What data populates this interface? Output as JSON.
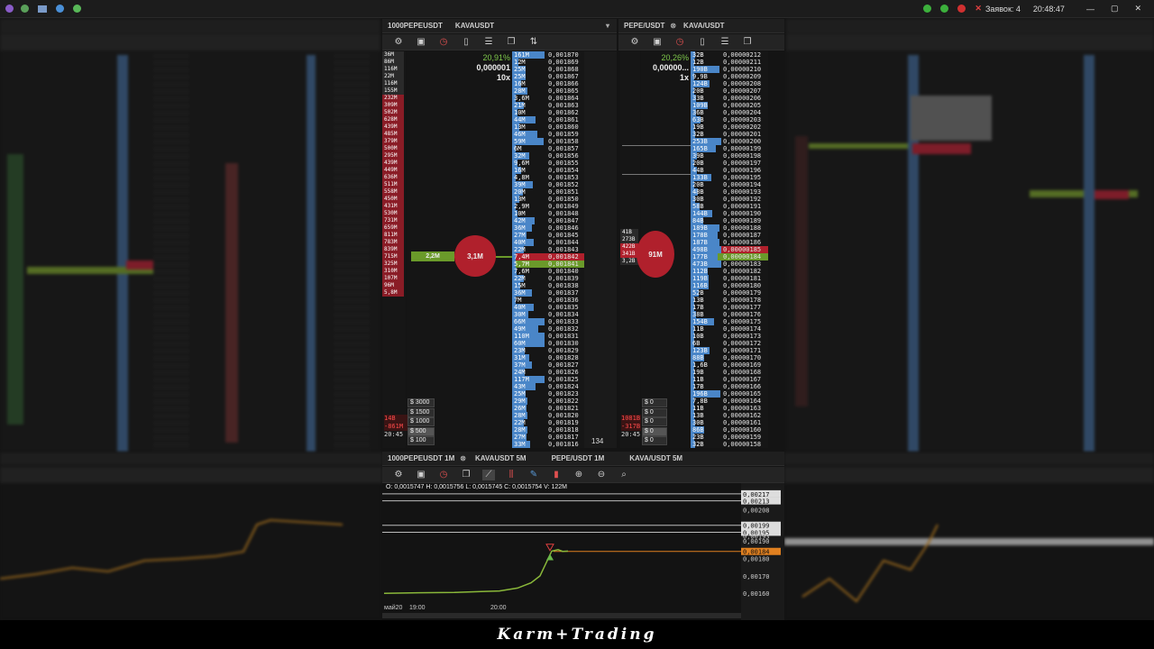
{
  "topbar": {
    "orders_label": "Заявок: 4",
    "clock": "20:48:47"
  },
  "panels": {
    "center_dom_tabs": [
      "1000PEPEUSDT",
      "KAVAUSDT"
    ],
    "right_dom_tabs": [
      "PEPE/USDT",
      "KAVA/USDT"
    ],
    "chart_tabs": [
      "1000PEPEUSDT 1M",
      "KAVAUSDT 5M",
      "PEPE/USDT 1M",
      "KAVA/USDT 5M"
    ]
  },
  "dom1": {
    "change": "20,91%",
    "tick": "0,000001",
    "mult": "10x",
    "bid_bubble": "2,2M",
    "circle": "3,1M",
    "bottom_count": "134",
    "amounts": [
      "$ 3000",
      "$ 1500",
      "$ 1000",
      "$ 500",
      "$ 100"
    ],
    "left_footer": [
      "14B",
      "-861M",
      "20:45"
    ],
    "left_sizes": [
      "36M",
      "86M",
      "116M",
      "22M",
      "116M",
      "155M",
      "232M",
      "309M",
      "502M",
      "628M",
      "439M",
      "485M",
      "379M",
      "500M",
      "295M",
      "439M",
      "449M",
      "636M",
      "511M",
      "558M",
      "450M",
      "431M",
      "530M",
      "731M",
      "659M",
      "811M",
      "783M",
      "839M",
      "715M",
      "325M",
      "310M",
      "107M",
      "96M",
      "5,8M"
    ],
    "rows": [
      [
        "161M",
        "0,001870"
      ],
      [
        "12M",
        "0,001869"
      ],
      [
        "25M",
        "0,001868"
      ],
      [
        "25M",
        "0,001867"
      ],
      [
        "16M",
        "0,001866"
      ],
      [
        "28M",
        "0,001865"
      ],
      [
        "3,6M",
        "0,001864"
      ],
      [
        "21M",
        "0,001863"
      ],
      [
        "10M",
        "0,001862"
      ],
      [
        "44M",
        "0,001861"
      ],
      [
        "13M",
        "0,001860"
      ],
      [
        "46M",
        "0,001859"
      ],
      [
        "59M",
        "0,001858"
      ],
      [
        "6M",
        "0,001857"
      ],
      [
        "32M",
        "0,001856"
      ],
      [
        "9,6M",
        "0,001855"
      ],
      [
        "16M",
        "0,001854"
      ],
      [
        "4,8M",
        "0,001853"
      ],
      [
        "39M",
        "0,001852"
      ],
      [
        "20M",
        "0,001851"
      ],
      [
        "13M",
        "0,001850"
      ],
      [
        "2,9M",
        "0,001849"
      ],
      [
        "10M",
        "0,001848"
      ],
      [
        "42M",
        "0,001847"
      ],
      [
        "36M",
        "0,001846"
      ],
      [
        "27M",
        "0,001845"
      ],
      [
        "40M",
        "0,001844"
      ],
      [
        "22M",
        "0,001843"
      ],
      [
        "7,4M",
        "0,001842"
      ],
      [
        "5,7M",
        "0,001841"
      ],
      [
        "7,6M",
        "0,001840"
      ],
      [
        "22M",
        "0,001839"
      ],
      [
        "15M",
        "0,001838"
      ],
      [
        "36M",
        "0,001837"
      ],
      [
        "7M",
        "0,001836"
      ],
      [
        "40M",
        "0,001835"
      ],
      [
        "30M",
        "0,001834"
      ],
      [
        "66M",
        "0,001833"
      ],
      [
        "49M",
        "0,001832"
      ],
      [
        "110M",
        "0,001831"
      ],
      [
        "60M",
        "0,001830"
      ],
      [
        "23M",
        "0,001829"
      ],
      [
        "31M",
        "0,001828"
      ],
      [
        "37M",
        "0,001827"
      ],
      [
        "24M",
        "0,001826"
      ],
      [
        "117M",
        "0,001825"
      ],
      [
        "43M",
        "0,001824"
      ],
      [
        "25M",
        "0,001823"
      ],
      [
        "29M",
        "0,001822"
      ],
      [
        "26M",
        "0,001821"
      ],
      [
        "28M",
        "0,001820"
      ],
      [
        "22M",
        "0,001819"
      ],
      [
        "28M",
        "0,001818"
      ],
      [
        "27M",
        "0,001817"
      ],
      [
        "33M",
        "0,001816"
      ]
    ]
  },
  "dom2": {
    "change": "20,26%",
    "tick": "0,00000...",
    "mult": "1x",
    "circle": "91M",
    "amounts": [
      "$ 0",
      "$ 0",
      "$ 0",
      "$ 0",
      "$ 0"
    ],
    "left_sizes": [
      "41B",
      "273B",
      "422B",
      "341B",
      "3,2B"
    ],
    "left_footer": [
      "1081B",
      "-317B",
      "20:45"
    ],
    "rows": [
      [
        "32B",
        "0,00000212"
      ],
      [
        "12B",
        "0,00000211"
      ],
      [
        "190B",
        "0,00000210"
      ],
      [
        "9,9B",
        "0,00000209"
      ],
      [
        "124B",
        "0,00000208"
      ],
      [
        "20B",
        "0,00000207"
      ],
      [
        "33B",
        "0,00000206"
      ],
      [
        "109B",
        "0,00000205"
      ],
      [
        "36B",
        "0,00000204"
      ],
      [
        "63B",
        "0,00000203"
      ],
      [
        "19B",
        "0,00000202"
      ],
      [
        "32B",
        "0,00000201"
      ],
      [
        "253B",
        "0,00000200"
      ],
      [
        "165B",
        "0,00000199"
      ],
      [
        "39B",
        "0,00000198"
      ],
      [
        "20B",
        "0,00000197"
      ],
      [
        "44B",
        "0,00000196"
      ],
      [
        "133B",
        "0,00000195"
      ],
      [
        "20B",
        "0,00000194"
      ],
      [
        "48B",
        "0,00000193"
      ],
      [
        "30B",
        "0,00000192"
      ],
      [
        "58B",
        "0,00000191"
      ],
      [
        "144B",
        "0,00000190"
      ],
      [
        "84B",
        "0,00000189"
      ],
      [
        "189B",
        "0,00000188"
      ],
      [
        "178B",
        "0,00000187"
      ],
      [
        "187B",
        "0,00000186"
      ],
      [
        "498B",
        "0,00000185"
      ],
      [
        "177B",
        "0,00000184"
      ],
      [
        "473B",
        "0,00000183"
      ],
      [
        "112B",
        "0,00000182"
      ],
      [
        "119B",
        "0,00000181"
      ],
      [
        "116B",
        "0,00000180"
      ],
      [
        "52B",
        "0,00000179"
      ],
      [
        "13B",
        "0,00000178"
      ],
      [
        "17B",
        "0,00000177"
      ],
      [
        "38B",
        "0,00000176"
      ],
      [
        "154B",
        "0,00000175"
      ],
      [
        "11B",
        "0,00000174"
      ],
      [
        "10B",
        "0,00000173"
      ],
      [
        "6B",
        "0,00000172"
      ],
      [
        "123B",
        "0,00000171"
      ],
      [
        "88B",
        "0,00000170"
      ],
      [
        "1,6B",
        "0,00000169"
      ],
      [
        "19B",
        "0,00000168"
      ],
      [
        "11B",
        "0,00000167"
      ],
      [
        "17B",
        "0,00000166"
      ],
      [
        "196B",
        "0,00000165"
      ],
      [
        "7,8B",
        "0,00000164"
      ],
      [
        "11B",
        "0,00000163"
      ],
      [
        "13B",
        "0,00000162"
      ],
      [
        "30B",
        "0,00000161"
      ],
      [
        "86B",
        "0,00000160"
      ],
      [
        "23B",
        "0,00000159"
      ],
      [
        "32B",
        "0,00000158"
      ]
    ]
  },
  "chart": {
    "ohlc": "O: 0,0015747  H: 0,0015756  L: 0,0015745  C: 0,0015754  V: 122M",
    "price_labels": [
      "0,00217",
      "0,00213",
      "0,00208",
      "0,00199",
      "0,00195",
      "0,00193",
      "0,00190",
      "0,00184",
      "0,00180",
      "0,00170",
      "0,00160"
    ],
    "time_labels": [
      "май20",
      "19:00",
      "20:00"
    ],
    "x": [
      "18:40",
      "19:00",
      "19:20",
      "19:40",
      "20:00",
      "20:10",
      "20:20",
      "20:25",
      "20:30",
      "20:35",
      "20:40",
      "20:45"
    ],
    "values": [
      0.0016,
      0.001603,
      0.001605,
      0.00161,
      0.001613,
      0.00163,
      0.00166,
      0.0017,
      0.001842,
      0.00185,
      0.00184,
      0.001842
    ]
  },
  "watermark": "Karm+Trading",
  "colors": {
    "bid": "#4a86c8",
    "ask_red": "#b0202c",
    "accent_green": "#7ec84a",
    "orange": "#e08020"
  }
}
